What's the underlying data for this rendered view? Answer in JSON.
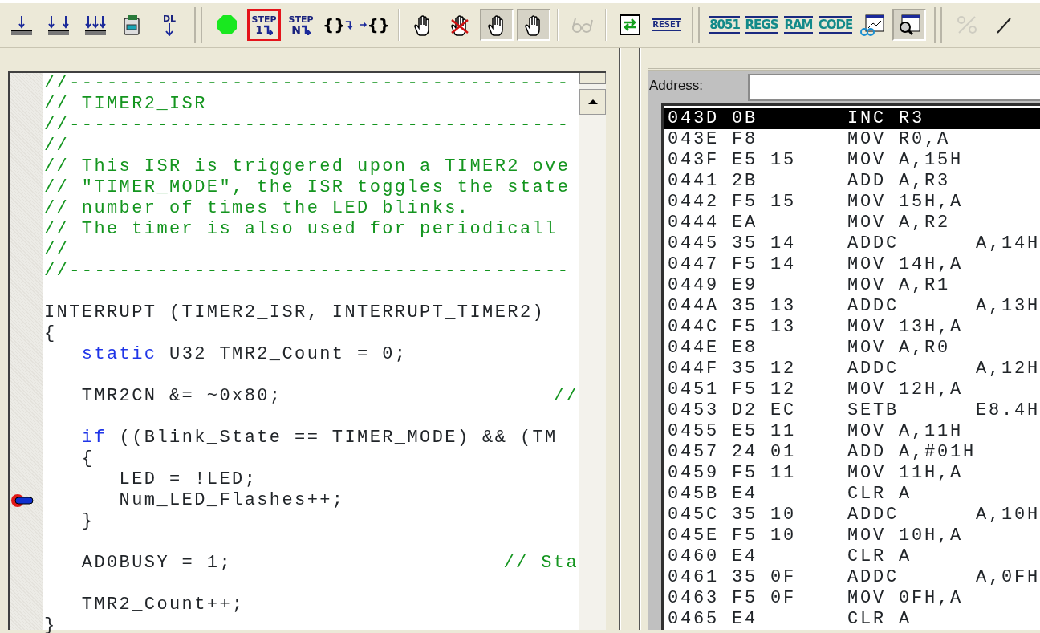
{
  "toolbar": [
    {
      "kind": "icon",
      "pressed": false,
      "disabled": false,
      "highlighted": false
    },
    {
      "kind": "icon",
      "pressed": false,
      "disabled": false,
      "highlighted": false
    },
    {
      "kind": "icon",
      "pressed": false,
      "disabled": false,
      "highlighted": false
    },
    {
      "kind": "icon",
      "pressed": false,
      "disabled": false,
      "highlighted": false
    },
    {
      "kind": "label-arrow",
      "label": "DL",
      "pressed": false,
      "disabled": false,
      "highlighted": false
    },
    {
      "kind": "grip"
    },
    {
      "kind": "icon",
      "pressed": false,
      "disabled": false,
      "highlighted": false
    },
    {
      "kind": "step",
      "label": "STEP",
      "sublabel": "1",
      "pressed": false,
      "disabled": false,
      "highlighted": true
    },
    {
      "kind": "step",
      "label": "STEP",
      "sublabel": "N",
      "pressed": false,
      "disabled": false,
      "highlighted": false
    },
    {
      "kind": "brace-out",
      "label": "{}",
      "pressed": false,
      "disabled": false,
      "highlighted": false
    },
    {
      "kind": "brace-in",
      "label": "{}",
      "pressed": false,
      "disabled": false,
      "highlighted": false
    },
    {
      "kind": "divider"
    },
    {
      "kind": "icon",
      "pressed": false,
      "disabled": false,
      "highlighted": false
    },
    {
      "kind": "icon",
      "pressed": false,
      "disabled": false,
      "highlighted": false
    },
    {
      "kind": "icon",
      "pressed": true,
      "disabled": false,
      "highlighted": false
    },
    {
      "kind": "icon",
      "pressed": true,
      "disabled": false,
      "highlighted": false
    },
    {
      "kind": "divider"
    },
    {
      "kind": "icon",
      "pressed": false,
      "disabled": true,
      "highlighted": false
    },
    {
      "kind": "divider"
    },
    {
      "kind": "icon",
      "pressed": false,
      "disabled": false,
      "highlighted": false
    },
    {
      "kind": "plate",
      "label": "RESET",
      "pressed": false,
      "disabled": false,
      "highlighted": false
    },
    {
      "kind": "grip"
    },
    {
      "kind": "bar-label",
      "label": "8051",
      "pressed": false,
      "disabled": false,
      "highlighted": false
    },
    {
      "kind": "bar-label",
      "label": "REGS",
      "pressed": false,
      "disabled": false,
      "highlighted": false
    },
    {
      "kind": "bar-label",
      "label": "RAM",
      "pressed": false,
      "disabled": false,
      "highlighted": false
    },
    {
      "kind": "bar-label",
      "label": "CODE",
      "pressed": false,
      "disabled": false,
      "highlighted": false
    },
    {
      "kind": "icon",
      "pressed": false,
      "disabled": false,
      "highlighted": false
    },
    {
      "kind": "icon",
      "pressed": true,
      "disabled": false,
      "highlighted": false
    },
    {
      "kind": "grip"
    },
    {
      "kind": "icon",
      "pressed": false,
      "disabled": true,
      "highlighted": false
    },
    {
      "kind": "icon",
      "pressed": false,
      "disabled": false,
      "highlighted": false
    }
  ],
  "editor": {
    "lines": [
      {
        "current": false,
        "tokens": [
          {
            "kind": "comment",
            "text": "//----------------------------------------"
          }
        ]
      },
      {
        "current": false,
        "tokens": [
          {
            "kind": "comment",
            "text": "// TIMER2_ISR"
          }
        ]
      },
      {
        "current": false,
        "tokens": [
          {
            "kind": "comment",
            "text": "//----------------------------------------"
          }
        ]
      },
      {
        "current": false,
        "tokens": [
          {
            "kind": "comment",
            "text": "//"
          }
        ]
      },
      {
        "current": false,
        "tokens": [
          {
            "kind": "comment",
            "text": "// This ISR is triggered upon a TIMER2 ove"
          }
        ]
      },
      {
        "current": false,
        "tokens": [
          {
            "kind": "comment",
            "text": "// \"TIMER_MODE\", the ISR toggles the state"
          }
        ]
      },
      {
        "current": false,
        "tokens": [
          {
            "kind": "comment",
            "text": "// number of times the LED blinks."
          }
        ]
      },
      {
        "current": false,
        "tokens": [
          {
            "kind": "comment",
            "text": "// The timer is also used for periodicall"
          }
        ]
      },
      {
        "current": false,
        "tokens": [
          {
            "kind": "comment",
            "text": "//"
          }
        ]
      },
      {
        "current": false,
        "tokens": [
          {
            "kind": "comment",
            "text": "//----------------------------------------"
          }
        ]
      },
      {
        "current": false
      },
      {
        "current": false,
        "tokens": [
          {
            "kind": "plain",
            "text": "INTERRUPT (TIMER2_ISR, INTERRUPT_TIMER2)"
          }
        ]
      },
      {
        "current": false,
        "tokens": [
          {
            "kind": "plain",
            "text": "{"
          }
        ]
      },
      {
        "current": false,
        "tokens": [
          {
            "kind": "keyword",
            "text": "   static"
          },
          {
            "kind": "plain",
            "text": " U32 TMR2_Count = 0;"
          }
        ]
      },
      {
        "current": false
      },
      {
        "current": false,
        "tokens": [
          {
            "kind": "plain",
            "text": "   TMR2CN &= ~0x80;"
          }
        ],
        "trailing_comment": "//"
      },
      {
        "current": false
      },
      {
        "current": false,
        "tokens": [
          {
            "kind": "keyword",
            "text": "   if"
          },
          {
            "kind": "plain",
            "text": " ((Blink_State == TIMER_MODE) && (TM"
          }
        ]
      },
      {
        "current": false,
        "tokens": [
          {
            "kind": "plain",
            "text": "   {"
          }
        ]
      },
      {
        "current": false,
        "tokens": [
          {
            "kind": "plain",
            "text": "      LED = !LED;"
          }
        ]
      },
      {
        "current": true,
        "tokens": [
          {
            "kind": "plain",
            "text": "      Num_LED_Flashes++;"
          }
        ]
      },
      {
        "current": false,
        "tokens": [
          {
            "kind": "plain",
            "text": "   }"
          }
        ]
      },
      {
        "current": false
      },
      {
        "current": false,
        "tokens": [
          {
            "kind": "plain",
            "text": "   AD0BUSY = 1;"
          }
        ],
        "trailing_comment": "// Sta"
      },
      {
        "current": false
      },
      {
        "current": false,
        "tokens": [
          {
            "kind": "plain",
            "text": "   TMR2_Count++;"
          }
        ]
      },
      {
        "current": false,
        "tokens": [
          {
            "kind": "plain",
            "text": "}"
          }
        ]
      }
    ]
  },
  "disassembly": {
    "address_label": "Address:",
    "rows": [
      {
        "address": "043D",
        "bytes": "0B",
        "instruction": "INC R3",
        "selected": true
      },
      {
        "address": "043E",
        "bytes": "F8",
        "instruction": "MOV R0,A",
        "selected": false
      },
      {
        "address": "043F",
        "bytes": "E5 15",
        "instruction": "MOV A,15H",
        "selected": false
      },
      {
        "address": "0441",
        "bytes": "2B",
        "instruction": "ADD A,R3",
        "selected": false
      },
      {
        "address": "0442",
        "bytes": "F5 15",
        "instruction": "MOV 15H,A",
        "selected": false
      },
      {
        "address": "0444",
        "bytes": "EA",
        "instruction": "MOV A,R2",
        "selected": false
      },
      {
        "address": "0445",
        "bytes": "35 14",
        "instruction": "ADDC",
        "operand": "A,14H",
        "selected": false
      },
      {
        "address": "0447",
        "bytes": "F5 14",
        "instruction": "MOV 14H,A",
        "selected": false
      },
      {
        "address": "0449",
        "bytes": "E9",
        "instruction": "MOV A,R1",
        "selected": false
      },
      {
        "address": "044A",
        "bytes": "35 13",
        "instruction": "ADDC",
        "operand": "A,13H",
        "selected": false
      },
      {
        "address": "044C",
        "bytes": "F5 13",
        "instruction": "MOV 13H,A",
        "selected": false
      },
      {
        "address": "044E",
        "bytes": "E8",
        "instruction": "MOV A,R0",
        "selected": false
      },
      {
        "address": "044F",
        "bytes": "35 12",
        "instruction": "ADDC",
        "operand": "A,12H",
        "selected": false
      },
      {
        "address": "0451",
        "bytes": "F5 12",
        "instruction": "MOV 12H,A",
        "selected": false
      },
      {
        "address": "0453",
        "bytes": "D2 EC",
        "instruction": "SETB",
        "operand": "E8.4H",
        "selected": false
      },
      {
        "address": "0455",
        "bytes": "E5 11",
        "instruction": "MOV A,11H",
        "selected": false
      },
      {
        "address": "0457",
        "bytes": "24 01",
        "instruction": "ADD A,#01H",
        "selected": false
      },
      {
        "address": "0459",
        "bytes": "F5 11",
        "instruction": "MOV 11H,A",
        "selected": false
      },
      {
        "address": "045B",
        "bytes": "E4",
        "instruction": "CLR A",
        "selected": false
      },
      {
        "address": "045C",
        "bytes": "35 10",
        "instruction": "ADDC",
        "operand": "A,10H",
        "selected": false
      },
      {
        "address": "045E",
        "bytes": "F5 10",
        "instruction": "MOV 10H,A",
        "selected": false
      },
      {
        "address": "0460",
        "bytes": "E4",
        "instruction": "CLR A",
        "selected": false
      },
      {
        "address": "0461",
        "bytes": "35 0F",
        "instruction": "ADDC",
        "operand": "A,0FH",
        "selected": false
      },
      {
        "address": "0463",
        "bytes": "F5 0F",
        "instruction": "MOV 0FH,A",
        "selected": false
      },
      {
        "address": "0465",
        "bytes": "E4",
        "instruction": "CLR A",
        "selected": false
      }
    ]
  }
}
